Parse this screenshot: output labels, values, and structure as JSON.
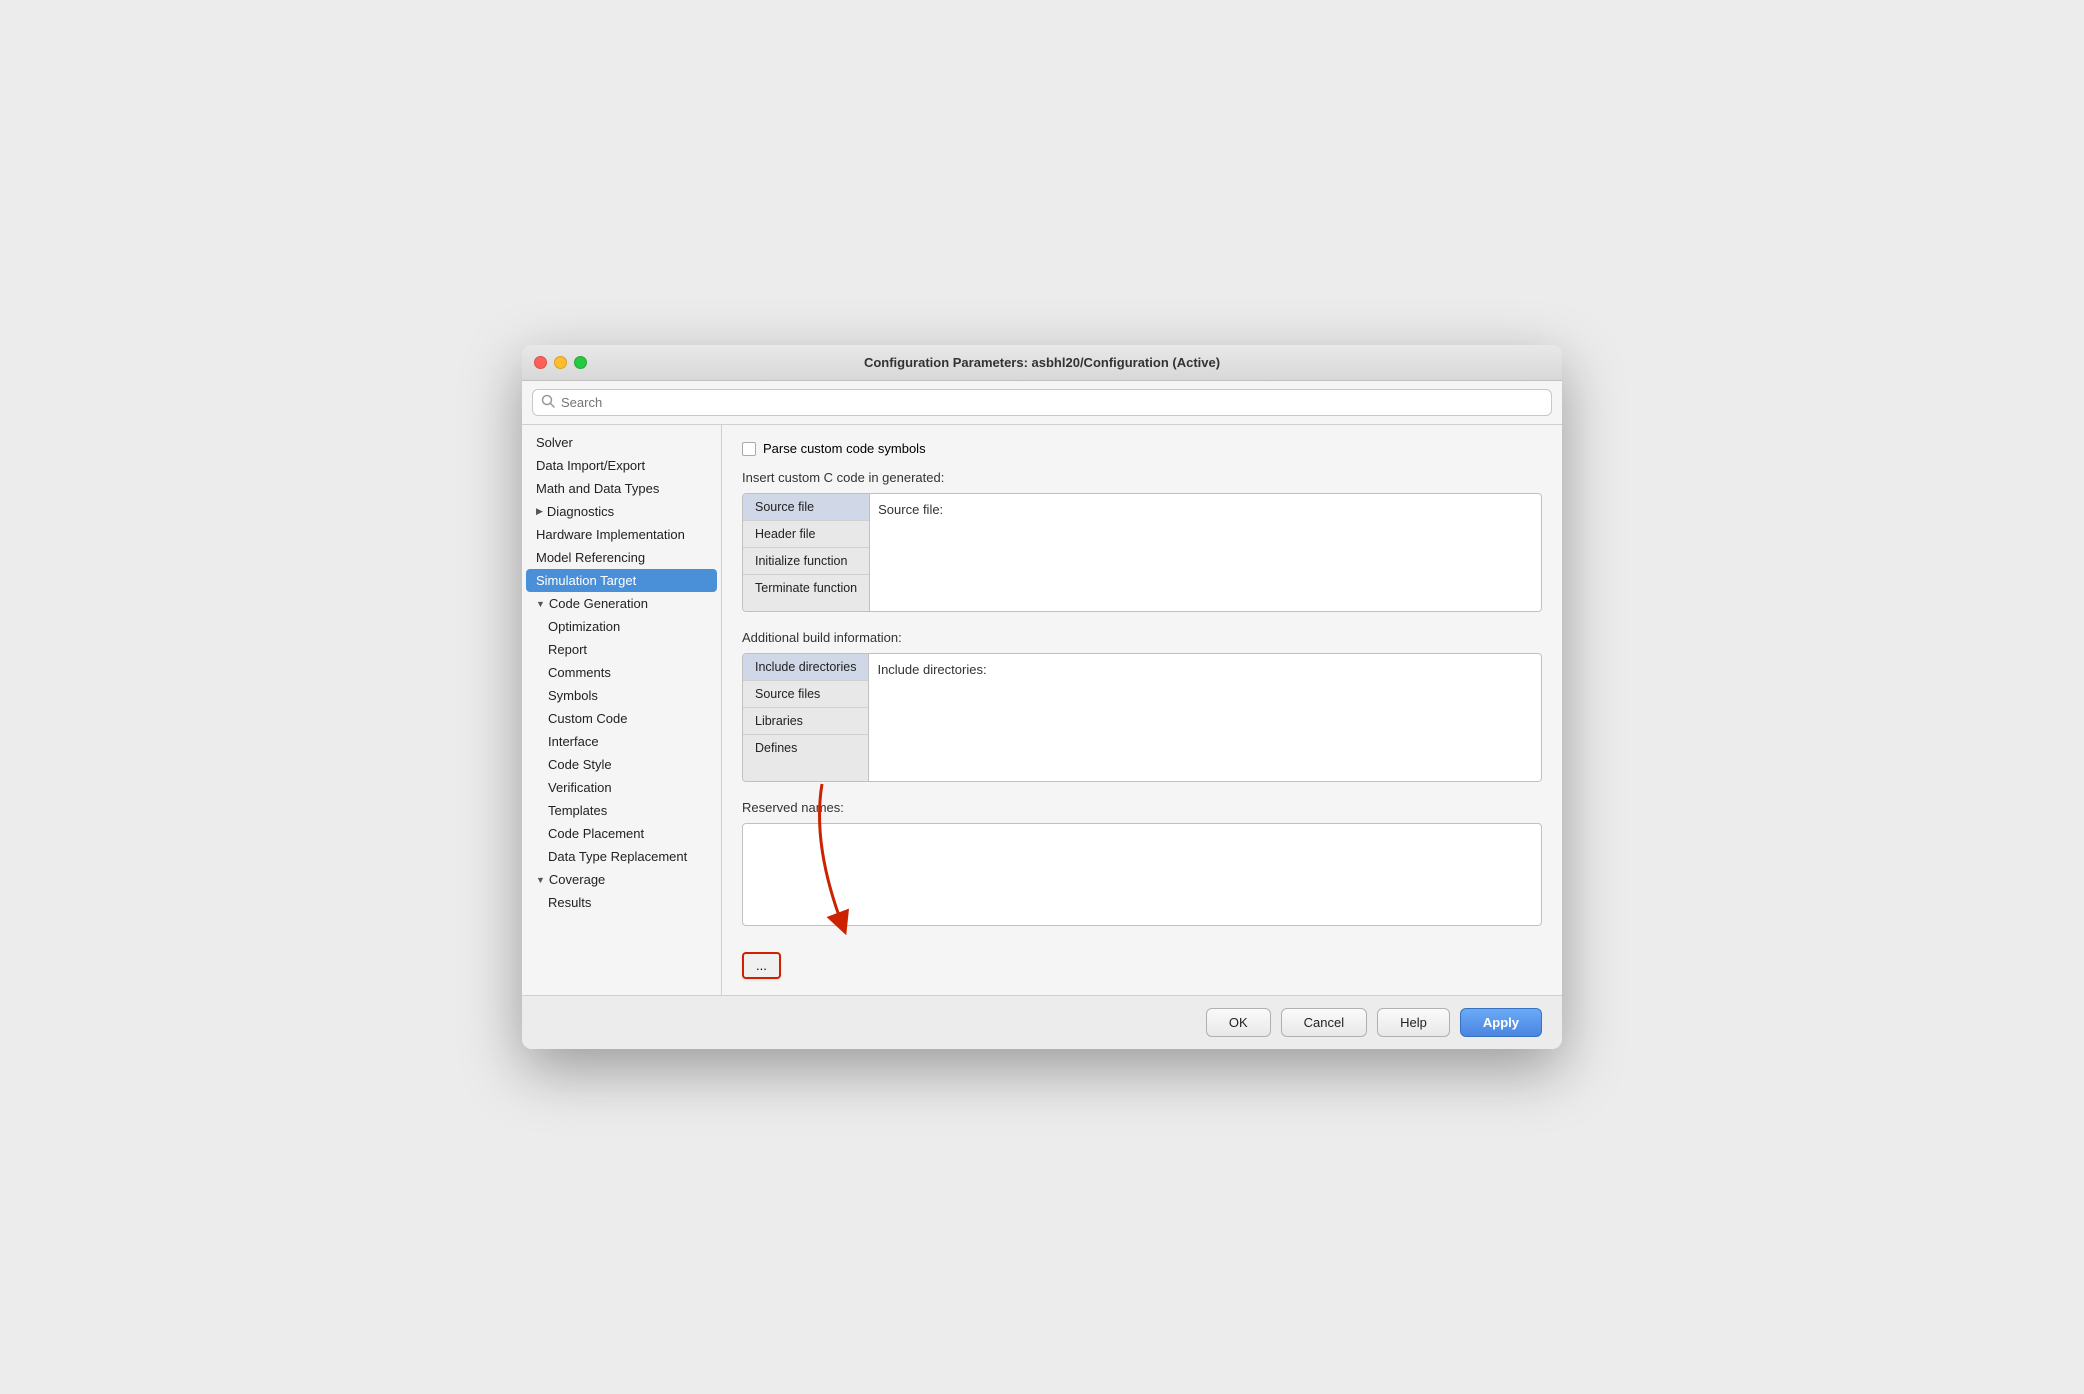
{
  "window": {
    "title": "Configuration Parameters: asbhl20/Configuration (Active)"
  },
  "search": {
    "placeholder": "Search"
  },
  "sidebar": {
    "items": [
      {
        "id": "solver",
        "label": "Solver",
        "level": 0,
        "selected": false
      },
      {
        "id": "data-import-export",
        "label": "Data Import/Export",
        "level": 0,
        "selected": false
      },
      {
        "id": "math-data-types",
        "label": "Math and Data Types",
        "level": 0,
        "selected": false
      },
      {
        "id": "diagnostics",
        "label": "Diagnostics",
        "level": 0,
        "selected": false,
        "expandable": true
      },
      {
        "id": "hardware-impl",
        "label": "Hardware Implementation",
        "level": 0,
        "selected": false
      },
      {
        "id": "model-referencing",
        "label": "Model Referencing",
        "level": 0,
        "selected": false
      },
      {
        "id": "simulation-target",
        "label": "Simulation Target",
        "level": 0,
        "selected": true
      },
      {
        "id": "code-generation",
        "label": "Code Generation",
        "level": 0,
        "selected": false,
        "expandable": true,
        "expanded": true
      },
      {
        "id": "optimization",
        "label": "Optimization",
        "level": 1,
        "selected": false
      },
      {
        "id": "report",
        "label": "Report",
        "level": 1,
        "selected": false
      },
      {
        "id": "comments",
        "label": "Comments",
        "level": 1,
        "selected": false
      },
      {
        "id": "symbols",
        "label": "Symbols",
        "level": 1,
        "selected": false
      },
      {
        "id": "custom-code",
        "label": "Custom Code",
        "level": 1,
        "selected": false
      },
      {
        "id": "interface",
        "label": "Interface",
        "level": 1,
        "selected": false
      },
      {
        "id": "code-style",
        "label": "Code Style",
        "level": 1,
        "selected": false
      },
      {
        "id": "verification",
        "label": "Verification",
        "level": 1,
        "selected": false
      },
      {
        "id": "templates",
        "label": "Templates",
        "level": 1,
        "selected": false
      },
      {
        "id": "code-placement",
        "label": "Code Placement",
        "level": 1,
        "selected": false
      },
      {
        "id": "data-type-replacement",
        "label": "Data Type Replacement",
        "level": 1,
        "selected": false
      },
      {
        "id": "coverage",
        "label": "Coverage",
        "level": 0,
        "selected": false,
        "expandable": true,
        "expanded": true
      },
      {
        "id": "results",
        "label": "Results",
        "level": 1,
        "selected": false
      }
    ]
  },
  "content": {
    "parse_custom_code_label": "Parse custom code symbols",
    "insert_custom_c_label": "Insert custom C code in generated:",
    "source_file_tabs": [
      {
        "id": "source-file",
        "label": "Source file"
      },
      {
        "id": "header-file",
        "label": "Header file"
      },
      {
        "id": "initialize-function",
        "label": "Initialize function"
      },
      {
        "id": "terminate-function",
        "label": "Terminate function"
      }
    ],
    "active_source_tab": "source-file",
    "source_file_panel_label": "Source file:",
    "additional_build_label": "Additional build information:",
    "build_tabs": [
      {
        "id": "include-dirs",
        "label": "Include directories"
      },
      {
        "id": "source-files",
        "label": "Source files"
      },
      {
        "id": "libraries",
        "label": "Libraries"
      },
      {
        "id": "defines",
        "label": "Defines"
      }
    ],
    "active_build_tab": "include-dirs",
    "include_dirs_label": "Include directories:",
    "reserved_names_label": "Reserved names:",
    "ellipsis_button_label": "..."
  },
  "footer": {
    "ok_label": "OK",
    "cancel_label": "Cancel",
    "help_label": "Help",
    "apply_label": "Apply"
  }
}
